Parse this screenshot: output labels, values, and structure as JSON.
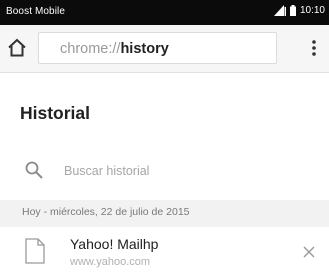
{
  "status_bar": {
    "carrier": "Boost Mobile",
    "time": "10:10"
  },
  "toolbar": {
    "url_scheme": "chrome://",
    "url_host": "history"
  },
  "history": {
    "title": "Historial",
    "search_placeholder": "Buscar historial",
    "date_header": "Hoy - miércoles, 22 de julio de 2015",
    "entries": [
      {
        "title": "Yahoo! Mailhp",
        "url": "www.yahoo.com"
      }
    ]
  },
  "icons": {
    "home": "home-icon",
    "menu": "overflow-menu-icon",
    "search": "search-icon",
    "page": "page-icon",
    "remove": "close-icon"
  }
}
